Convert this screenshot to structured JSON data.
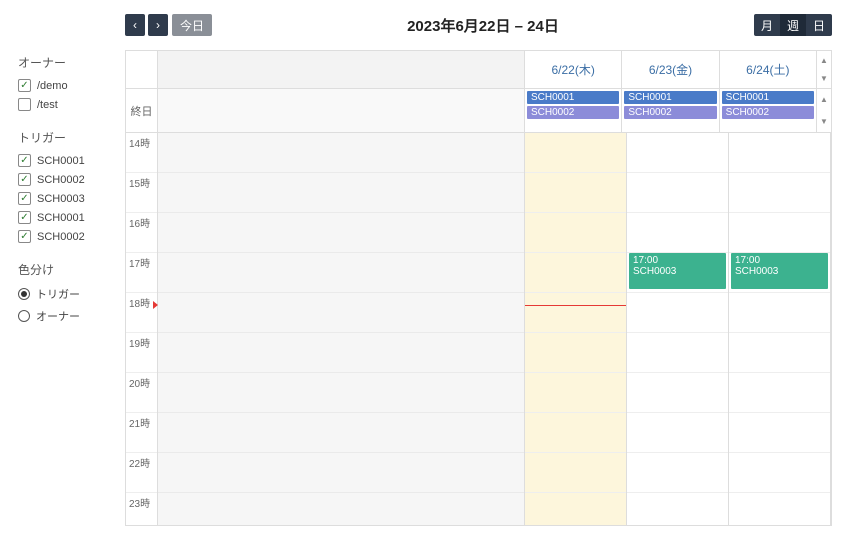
{
  "sidebar": {
    "owner_title": "オーナー",
    "owners": [
      {
        "label": "/demo",
        "checked": true
      },
      {
        "label": "/test",
        "checked": false
      }
    ],
    "trigger_title": "トリガー",
    "triggers": [
      {
        "label": "SCH0001",
        "checked": true
      },
      {
        "label": "SCH0002",
        "checked": true
      },
      {
        "label": "SCH0003",
        "checked": true
      },
      {
        "label": "SCH0001",
        "checked": true
      },
      {
        "label": "SCH0002",
        "checked": true
      }
    ],
    "color_title": "色分け",
    "color_options": [
      {
        "label": "トリガー",
        "selected": true
      },
      {
        "label": "オーナー",
        "selected": false
      }
    ]
  },
  "toolbar": {
    "today": "今日",
    "title": "2023年6月22日 – 24日",
    "views": {
      "month": "月",
      "week": "週",
      "day": "日"
    },
    "active_view": "week"
  },
  "calendar": {
    "days": [
      "6/22(木)",
      "6/23(金)",
      "6/24(土)"
    ],
    "today_index": 0,
    "allday_label": "終日",
    "allday_events": [
      [
        {
          "label": "SCH0001",
          "color": "ev-blue"
        },
        {
          "label": "SCH0002",
          "color": "ev-purple"
        }
      ],
      [
        {
          "label": "SCH0001",
          "color": "ev-blue"
        },
        {
          "label": "SCH0002",
          "color": "ev-purple"
        }
      ],
      [
        {
          "label": "SCH0001",
          "color": "ev-blue"
        },
        {
          "label": "SCH0002",
          "color": "ev-purple"
        }
      ]
    ],
    "hours": [
      "14時",
      "15時",
      "16時",
      "17時",
      "18時",
      "19時",
      "20時",
      "21時",
      "22時",
      "23時"
    ],
    "now_hour_index": 4,
    "now_offset_fraction": 0.3,
    "timed_events": [
      {
        "day": 1,
        "hour_index": 3,
        "duration_slots": 1,
        "time": "17:00",
        "label": "SCH0003",
        "color": "ev-green"
      },
      {
        "day": 2,
        "hour_index": 3,
        "duration_slots": 1,
        "time": "17:00",
        "label": "SCH0003",
        "color": "ev-green"
      }
    ]
  }
}
